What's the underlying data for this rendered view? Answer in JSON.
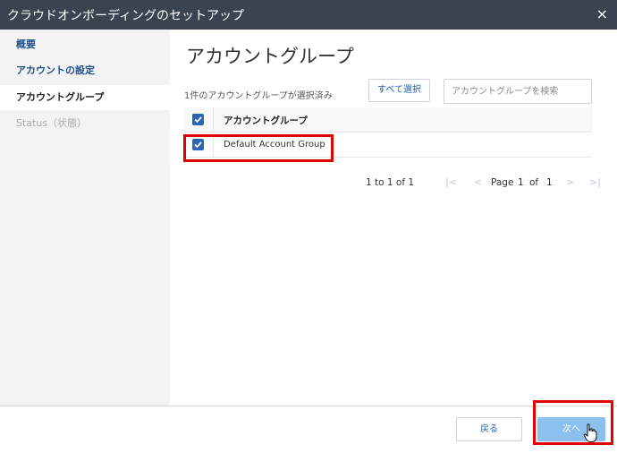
{
  "window": {
    "title": "クラウドオンボーディングのセットアップ",
    "close_glyph": "×"
  },
  "sidebar": {
    "items": [
      {
        "label": "概要",
        "state": "done"
      },
      {
        "label": "アカウントの設定",
        "state": "done"
      },
      {
        "label": "アカウントグループ",
        "state": "active"
      },
      {
        "label": "Status（状態）",
        "state": "disabled"
      }
    ]
  },
  "main": {
    "title": "アカウントグループ",
    "selected_count": "1件のアカウントグループが選択済み",
    "select_all_label": "すべて選択",
    "search_placeholder": "アカウントグループを検索",
    "table": {
      "header": "アカウントグループ",
      "rows": [
        {
          "name": "Default Account Group",
          "checked": true
        }
      ]
    },
    "pager": {
      "range": "1 to 1 of 1",
      "first": "|<",
      "prev": "<",
      "page_label": "Page",
      "page": "1",
      "of": "of",
      "total": "1",
      "next": ">",
      "last": ">|"
    }
  },
  "footer": {
    "back_label": "戻る",
    "next_label": "次へ"
  },
  "colors": {
    "titlebar": "#3b4350",
    "accent": "#2a65b3",
    "next_button": "#8cc1ef",
    "highlight_box": "#e30000"
  }
}
